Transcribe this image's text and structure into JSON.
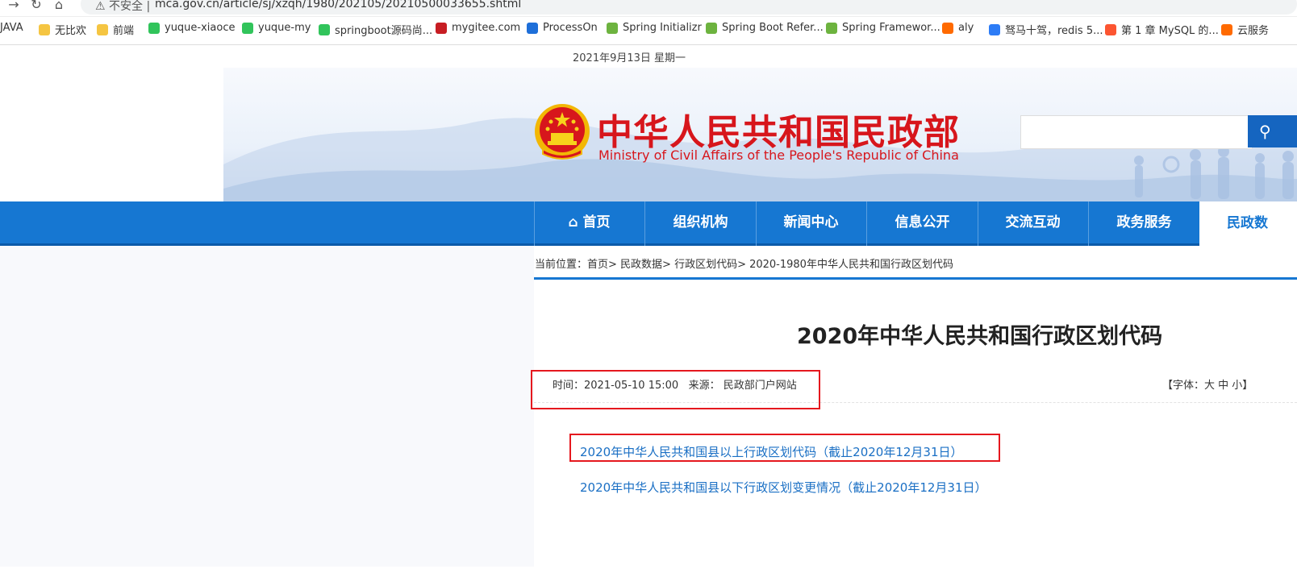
{
  "browser": {
    "security_label": "不安全",
    "url": "mca.gov.cn/article/sj/xzqh/1980/202105/20210500033655.shtml",
    "bookmarks": [
      {
        "label": "JAVA",
        "icon": "folder-icon",
        "color": "#f5c542"
      },
      {
        "label": "无比欢",
        "icon": "folder-icon",
        "color": "#f5c542"
      },
      {
        "label": "前端",
        "icon": "folder-icon",
        "color": "#f5c542"
      },
      {
        "label": "yuque-xiaoce",
        "icon": "yuque-icon",
        "color": "#31c45b"
      },
      {
        "label": "yuque-my",
        "icon": "yuque-icon",
        "color": "#31c45b"
      },
      {
        "label": "springboot源码尚...",
        "icon": "yuque-icon",
        "color": "#31c45b"
      },
      {
        "label": "mygitee.com",
        "icon": "gitee-icon",
        "color": "#c71d23"
      },
      {
        "label": "ProcessOn",
        "icon": "processon-icon",
        "color": "#1e6fd9"
      },
      {
        "label": "Spring Initializr",
        "icon": "spring-icon",
        "color": "#6db33f"
      },
      {
        "label": "Spring Boot Refer...",
        "icon": "spring-icon",
        "color": "#6db33f"
      },
      {
        "label": "Spring Framewor...",
        "icon": "spring-icon",
        "color": "#6db33f"
      },
      {
        "label": "aly",
        "icon": "aliyun-icon",
        "color": "#ff6a00"
      },
      {
        "label": "驽马十驾，redis 5...",
        "icon": "bookmark-icon",
        "color": "#2d7cf6"
      },
      {
        "label": "第 1 章 MySQL 的...",
        "icon": "csdn-icon",
        "color": "#fc5531"
      },
      {
        "label": "云服务",
        "icon": "aliyun-icon",
        "color": "#ff6a00"
      }
    ]
  },
  "header": {
    "date": "2021年9月13日 星期一",
    "ministry_cn": "中华人民共和国民政部",
    "ministry_en": "Ministry of Civil Affairs of the People's Republic of China",
    "search_placeholder": ""
  },
  "nav": {
    "items": [
      {
        "label": "首页",
        "icon": "home-icon"
      },
      {
        "label": "组织机构"
      },
      {
        "label": "新闻中心"
      },
      {
        "label": "信息公开"
      },
      {
        "label": "交流互动"
      },
      {
        "label": "政务服务"
      }
    ],
    "active": "民政数"
  },
  "breadcrumb": {
    "prefix": "当前位置：",
    "path": "首页> 民政数据> 行政区划代码> 2020-1980年中华人民共和国行政区划代码"
  },
  "article": {
    "title": "2020年中华人民共和国行政区划代码",
    "time_label": "时间：",
    "time": "2021-05-10 15:00",
    "source_label": "来源：",
    "source": "民政部门户网站",
    "fontsize_label": "【字体：大  中  小】",
    "links": [
      "2020年中华人民共和国县以上行政区划代码（截止2020年12月31日）",
      "2020年中华人民共和国县以下行政区划变更情况（截止2020年12月31日）"
    ]
  },
  "colors": {
    "nav_blue": "#1677d2",
    "ministry_red": "#d7161c",
    "annotation_red": "#e5181e",
    "link_blue": "#1a6fc4"
  }
}
